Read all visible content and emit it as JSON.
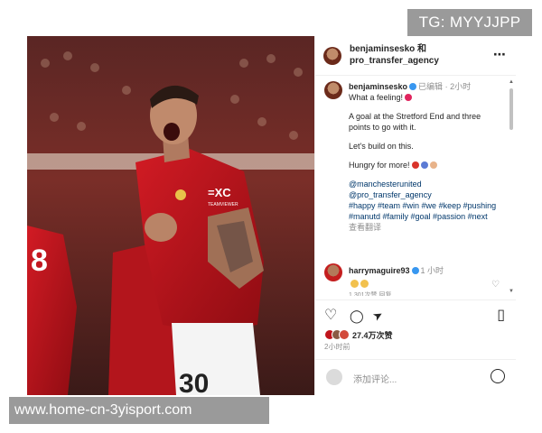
{
  "watermark_top": "TG: MYYJJPP",
  "watermark_bottom": "www.home-cn-3yisport.com",
  "photo": {
    "jersey_sponsor": "TEAMVIEWER",
    "jersey_number": "30",
    "left_player_number": "8"
  },
  "header": {
    "line1": "benjaminsesko 和",
    "line2": "pro_transfer_agency",
    "more_icon": "⋯"
  },
  "caption": {
    "username": "benjaminsesko",
    "edited": "已编辑",
    "dot": "·",
    "time": "2小时",
    "lines": [
      "What a feeling!",
      "A goal at the Stretford End and three points to go with it.",
      "Let's build on this.",
      "Hungry for more!"
    ],
    "mention1": "@manchesterunited",
    "mention2": "@pro_transfer_agency",
    "hashtags": "#happy #team #win #we #keep #pushing #manutd #family #goal #passion #next",
    "translate": "查看翻译"
  },
  "comment": {
    "username": "harrymaguire93",
    "time": "1 小时",
    "partial": "1,301次赞 回复"
  },
  "actions": {
    "like_icon": "♡",
    "comment_icon": "◯",
    "share_icon": "➤",
    "save_icon": "▯",
    "likes": "27.4万次赞",
    "timestamp": "2小时前"
  },
  "add_comment": {
    "placeholder": "添加评论..."
  },
  "colors": {
    "watermark_bg": "#9a9a9a",
    "verified": "#3897f0",
    "link": "#00376b",
    "jersey_red": "#c0141c"
  }
}
